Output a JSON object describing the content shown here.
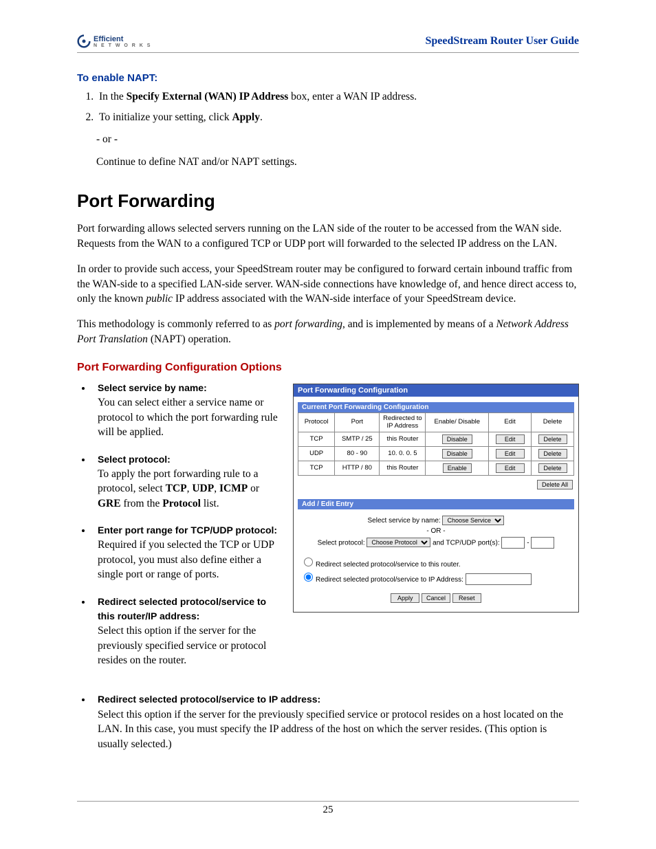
{
  "header": {
    "logo_line1": "Efficient",
    "logo_line2": "N E T W O R K S",
    "doc_title": "SpeedStream Router User Guide"
  },
  "section_napt": {
    "heading": "To enable NAPT:",
    "step1_pre": "In the ",
    "step1_bold": "Specify External (WAN) IP Address",
    "step1_post": " box, enter a WAN IP address.",
    "step2_pre": "To initialize your setting, click ",
    "step2_bold": "Apply",
    "step2_post": ".",
    "or": "- or -",
    "continue": "Continue to define NAT and/or NAPT settings."
  },
  "section_pf": {
    "heading": "Port Forwarding",
    "para1": "Port forwarding allows selected servers running on the LAN side of the router to be accessed from the WAN side. Requests from the WAN to a configured TCP or UDP port will forwarded to the selected IP address on the LAN.",
    "para2_a": "In order to provide such access, your SpeedStream router may be configured to forward certain inbound traffic from the WAN-side to a specified LAN-side server. WAN-side connections have knowledge of, and hence direct access to, only the known ",
    "para2_i": "public",
    "para2_b": " IP address associated with the WAN-side interface of your SpeedStream device.",
    "para3_a": "This methodology is commonly referred to as ",
    "para3_i1": "port forwarding",
    "para3_b": ", and is implemented by means of a ",
    "para3_i2": "Network Address Port Translation",
    "para3_c": " (NAPT) operation.",
    "config_heading": "Port Forwarding Configuration Options",
    "opts": [
      {
        "title": "Select service by name:",
        "body": "You can select either a service name or protocol to which the port forwarding rule will be applied."
      },
      {
        "title": "Select protocol:",
        "body_a": "To apply the port forwarding rule to a protocol, select ",
        "b1": "TCP",
        "b2": "UDP",
        "b3": "ICMP",
        "b4": "GRE",
        "body_b": " from the ",
        "b5": "Protocol",
        "body_c": " list."
      },
      {
        "title": "Enter port range for TCP/UDP protocol:",
        "body": "Required if you selected the TCP or UDP protocol, you must also define either a single port or range of ports."
      },
      {
        "title": "Redirect selected protocol/service to this router/IP address:",
        "body": "Select this option if the server for the previously specified service or protocol resides on the router."
      },
      {
        "title": "Redirect selected protocol/service to IP address:",
        "body": "Select this option if the server for the previously specified service or protocol resides on a host located on the LAN. In this case, you must specify the IP address of the host on which the server resides. (This option is usually selected.)"
      }
    ]
  },
  "panel": {
    "title": "Port Forwarding Configuration",
    "subtitle": "Current Port Forwarding Configuration",
    "cols": [
      "Protocol",
      "Port",
      "Redirected to IP Address",
      "Enable/ Disable",
      "Edit",
      "Delete"
    ],
    "rows": [
      {
        "proto": "TCP",
        "port": "SMTP / 25",
        "ip": "this Router",
        "action": "Disable"
      },
      {
        "proto": "UDP",
        "port": "80 - 90",
        "ip": "10. 0. 0. 5",
        "action": "Disable"
      },
      {
        "proto": "TCP",
        "port": "HTTP / 80",
        "ip": "this Router",
        "action": "Enable"
      }
    ],
    "edit_btn": "Edit",
    "delete_btn": "Delete",
    "delete_all": "Delete All",
    "addedit": "Add / Edit Entry",
    "svc_label": "Select service by name:",
    "svc_sel": "Choose Service",
    "or": "- OR -",
    "proto_label": "Select protocol:",
    "proto_sel": "Choose Protocol",
    "ports_label": "and TCP/UDP port(s):",
    "dash": "-",
    "radio1": "Redirect selected protocol/service to this router.",
    "radio2": "Redirect selected protocol/service to IP Address:",
    "apply": "Apply",
    "cancel": "Cancel",
    "reset": "Reset"
  },
  "page_number": "25"
}
